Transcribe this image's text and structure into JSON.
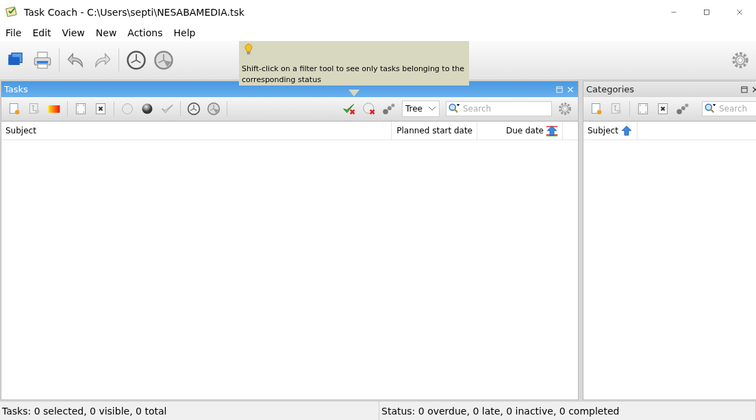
{
  "window": {
    "title": "Task Coach - C:\\Users\\septi\\NESABAMEDIA.tsk"
  },
  "menu": [
    "File",
    "Edit",
    "View",
    "New",
    "Actions",
    "Help"
  ],
  "tooltip": {
    "text": "Shift-click on a filter tool to see only tasks belonging to the corresponding status"
  },
  "tasks_pane": {
    "title": "Tasks",
    "active": true,
    "view_select": {
      "value": "Tree"
    },
    "search": {
      "placeholder": "Search"
    },
    "columns": [
      {
        "label": "Subject",
        "sorted": false
      },
      {
        "label": "Planned start date",
        "sorted": false
      },
      {
        "label": "Due date",
        "sorted": true
      }
    ]
  },
  "categories_pane": {
    "title": "Categories",
    "active": false,
    "search": {
      "placeholder": "Search"
    },
    "columns": [
      {
        "label": "Subject",
        "sorted": true
      }
    ]
  },
  "status_bar": [
    "Tasks: 0 selected, 0 visible, 0 total",
    "Status: 0 overdue, 0 late, 0 inactive, 0 completed"
  ]
}
